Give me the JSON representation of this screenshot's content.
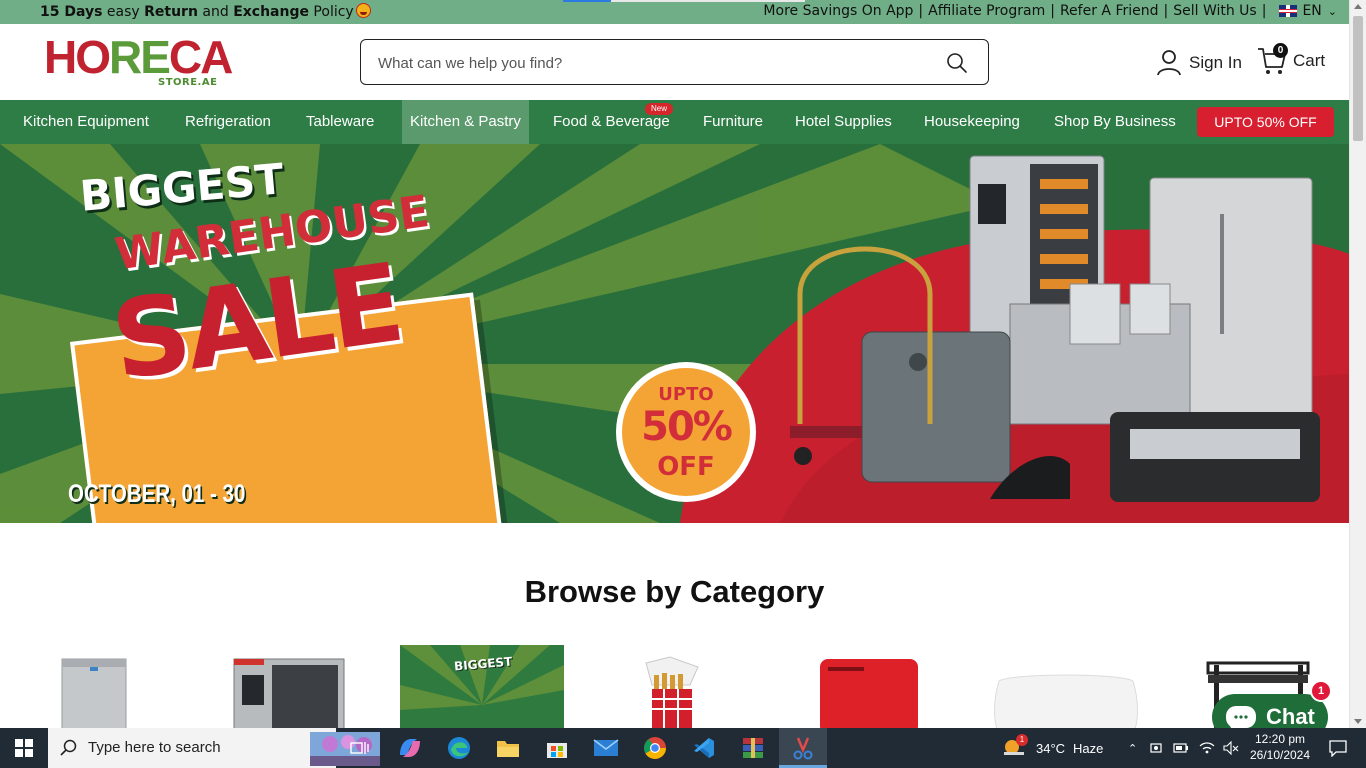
{
  "topbar": {
    "promo_bold1": "15 Days",
    "promo_text1": " easy ",
    "promo_bold2": "Return",
    "promo_text2": " and ",
    "promo_bold3": "Exchange",
    "promo_text3": " Policy",
    "links": [
      "More Savings On App",
      "Affiliate Program",
      "Refer A Friend",
      "Sell With Us"
    ],
    "separator": "|",
    "language": "EN"
  },
  "header": {
    "logo_part1": "HO",
    "logo_part2": "RE",
    "logo_part3": "CA",
    "logo_sub": "STORE.AE",
    "search_placeholder": "What can we help you find?",
    "sign_in": "Sign In",
    "cart_label": "Cart",
    "cart_count": "0"
  },
  "nav": {
    "items": [
      "Kitchen Equipment",
      "Refrigeration",
      "Tableware",
      "Kitchen & Pastry",
      "Food & Beverage",
      "Furniture",
      "Hotel Supplies",
      "Housekeeping",
      "Shop By Business"
    ],
    "new_badge": "New",
    "sale_button": "UPTO 50% OFF",
    "active_index": 3
  },
  "hero": {
    "line1": "BIGGEST",
    "line2": "WAREHOUSE",
    "line3": "SALE",
    "dates": "OCTOBER, 01 - 30",
    "badge_top": "UPTO",
    "badge_mid": "50%",
    "badge_bottom": "OFF"
  },
  "browse": {
    "title": "Browse by Category",
    "card_text": "BIGGEST"
  },
  "chat": {
    "label": "Chat",
    "badge": "1"
  },
  "taskbar": {
    "search_text": "Type here to search",
    "weather_temp": "34°C",
    "weather_desc": "Haze",
    "weather_badge": "1",
    "time": "12:20 pm",
    "date": "26/10/2024"
  },
  "colors": {
    "brand_green": "#2e7d46",
    "topbar_green": "#6fae86",
    "sale_red": "#d71f30",
    "hero_orange": "#f4a335"
  }
}
